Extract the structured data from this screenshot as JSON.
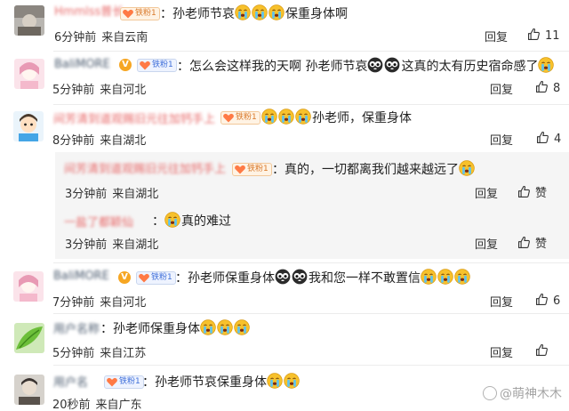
{
  "comments": [
    {
      "username": "Hmmlss普长",
      "badge": "铁粉1",
      "text": "：孙老师节哀",
      "trail_text": "保重身体啊",
      "time": "6分钟前",
      "location": "来自云南",
      "reply_label": "回复",
      "likes": "11"
    },
    {
      "username": "BaliMORE",
      "badge": "铁粉1",
      "text": "：怎么会这样我的天啊 孙老师节哀",
      "trail_text": "这真的太有历史宿命感了",
      "time": "5分钟前",
      "location": "来自河北",
      "reply_label": "回复",
      "likes": "8"
    },
    {
      "username": "间芳清到道观赐旧元往加钙手上",
      "badge": "铁粉1",
      "text": "孙老师，保重身体",
      "time": "8分钟前",
      "location": "来自湖北",
      "reply_label": "回复",
      "likes": "4"
    },
    {
      "username": "间芳清到道观赐旧元往加钙手上",
      "badge": "铁粉1",
      "text": "：真的，一切都离我们越来越远了",
      "time": "3分钟前",
      "location": "来自湖北",
      "reply_label": "回复",
      "like_label": "赞"
    },
    {
      "username": "一盐了都颖仙",
      "text": "真的难过",
      "time": "3分钟前",
      "location": "来自湖北",
      "reply_label": "回复",
      "like_label": "赞"
    },
    {
      "username": "BaliMORE",
      "badge": "铁粉1",
      "text": "：孙老师保重身体",
      "mid_text": "我和您一样不敢置信",
      "time": "7分钟前",
      "location": "来自河北",
      "reply_label": "回复",
      "likes": "6"
    },
    {
      "username": "用户名称",
      "text": "：孙老师保重身体",
      "time": "5分钟前",
      "location": "来自江苏",
      "reply_label": "回复"
    },
    {
      "username": "用户名",
      "badge": "铁粉1",
      "text": "：孙老师节哀保重身体",
      "time": "20秒前",
      "location": "来自广东"
    }
  ],
  "watermark": "@萌神木木",
  "emoji": "crying-face-emoji",
  "colors": {
    "username": "#e86a6a",
    "badge_blue": "#3f6fd9",
    "badge_orange": "#d9792b",
    "subreply_bg": "#f5f5f5"
  }
}
